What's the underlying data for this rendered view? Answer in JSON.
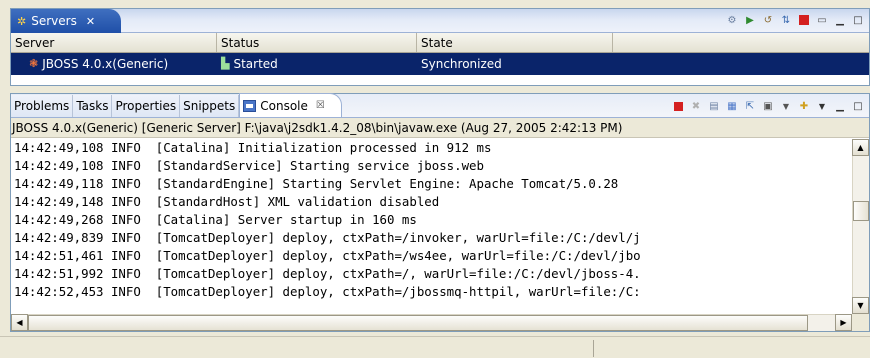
{
  "servers_view": {
    "tab_title": "Servers",
    "columns": [
      "Server",
      "Status",
      "State"
    ],
    "rows": [
      {
        "server": "JBOSS 4.0.x(Generic)",
        "status": "Started",
        "state": "Synchronized"
      }
    ]
  },
  "bottom_view": {
    "tabs": [
      "Problems",
      "Tasks",
      "Properties",
      "Snippets",
      "Console"
    ],
    "console_description": "JBOSS 4.0.x(Generic) [Generic Server] F:\\java\\j2sdk1.4.2_08\\bin\\javaw.exe (Aug 27, 2005 2:42:13 PM)",
    "log_lines": [
      "14:42:49,108 INFO  [Catalina] Initialization processed in 912 ms",
      "14:42:49,108 INFO  [StandardService] Starting service jboss.web",
      "14:42:49,118 INFO  [StandardEngine] Starting Servlet Engine: Apache Tomcat/5.0.28",
      "14:42:49,148 INFO  [StandardHost] XML validation disabled",
      "14:42:49,268 INFO  [Catalina] Server startup in 160 ms",
      "14:42:49,839 INFO  [TomcatDeployer] deploy, ctxPath=/invoker, warUrl=file:/C:/devl/j",
      "14:42:51,461 INFO  [TomcatDeployer] deploy, ctxPath=/ws4ee, warUrl=file:/C:/devl/jbo",
      "14:42:51,992 INFO  [TomcatDeployer] deploy, ctxPath=/, warUrl=file:/C:/devl/jboss-4.",
      "14:42:52,453 INFO  [TomcatDeployer] deploy, ctxPath=/jbossmq-httpil, warUrl=file:/C:"
    ]
  },
  "colors": {
    "selection": "#0a246a",
    "active_tab": "#1f4fa8",
    "terminate_red": "#d42020"
  }
}
